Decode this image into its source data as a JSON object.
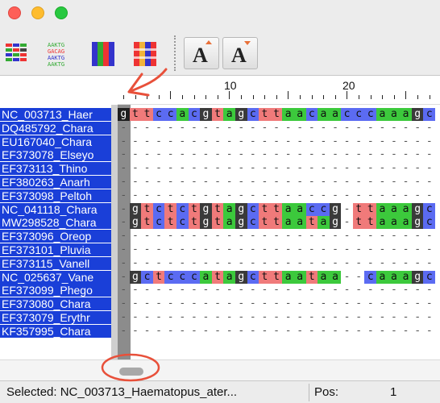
{
  "window": {
    "controls": [
      "close",
      "minimize",
      "zoom"
    ]
  },
  "toolbar": {
    "buttons": [
      {
        "icon": "color-blocks-view-icon"
      },
      {
        "icon": "text-letters-view-icon"
      },
      {
        "icon": "color-columns-view-icon"
      },
      {
        "icon": "color-letter-columns-view-icon"
      },
      {
        "icon": "font-increase-icon"
      },
      {
        "icon": "font-decrease-icon"
      }
    ]
  },
  "ruler": {
    "labels": [
      "10",
      "20"
    ]
  },
  "sequences": [
    {
      "name": "NC_003713_Haer",
      "seq": "gttccacgtagcttaacaacccaaagc"
    },
    {
      "name": "DQ485792_Chara",
      "seq": "---------------------------"
    },
    {
      "name": "EU167040_Chara",
      "seq": "---------------------------"
    },
    {
      "name": "EF373078_Elseyo",
      "seq": "---------------------------"
    },
    {
      "name": "EF373113_Thino",
      "seq": "---------------------------"
    },
    {
      "name": "EF380263_Anarh",
      "seq": "---------------------------"
    },
    {
      "name": "EF373098_Peltoh",
      "seq": "---------------------------"
    },
    {
      "name": "NC_041118_Chara",
      "seq": "-gtctctgtagcttaaccg-ttaaagc"
    },
    {
      "name": "MW298528_Chara",
      "seq": "-gtctctgtagcttaatag-ttaaagc"
    },
    {
      "name": "EF373096_Oreop",
      "seq": "---------------------------"
    },
    {
      "name": "EF373101_Pluvia",
      "seq": "---------------------------"
    },
    {
      "name": "EF373115_Vanell",
      "seq": "---------------------------"
    },
    {
      "name": "NC_025637_Vane",
      "seq": "-gctcccatagcttaataa--caaagc"
    },
    {
      "name": "EF373099_Phego",
      "seq": "---------------------------"
    },
    {
      "name": "EF373080_Chara",
      "seq": "---------------------------"
    },
    {
      "name": "EF373079_Erythr",
      "seq": "---------------------------"
    },
    {
      "name": "KF357995_Chara",
      "seq": "---------------------------"
    }
  ],
  "status": {
    "selected_label": "Selected:",
    "selected_value": "NC_003713_Haematopus_ater...",
    "pos_label": "Pos:",
    "pos_value": "1"
  },
  "colors": {
    "a": "#3cc93c",
    "c": "#5b6bf2",
    "g": "#3a3a3a",
    "t": "#f07a7a",
    "selection": "#1a3fd8",
    "annotation": "#e8503a"
  }
}
